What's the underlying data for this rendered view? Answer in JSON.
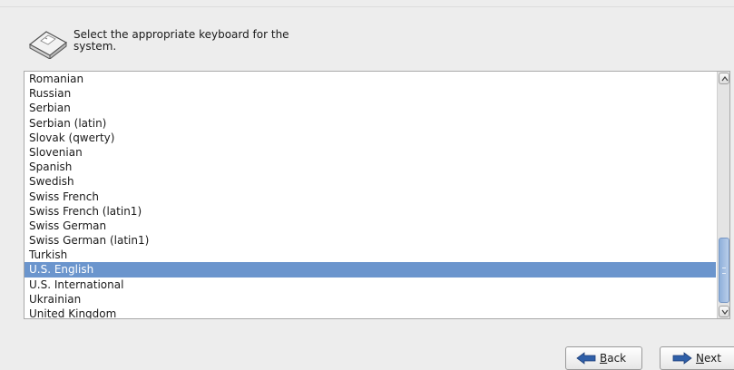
{
  "header": {
    "icon": "keyboard-icon",
    "prompt": "Select the appropriate keyboard for the system."
  },
  "keyboard_list": {
    "items": [
      "Romanian",
      "Russian",
      "Serbian",
      "Serbian (latin)",
      "Slovak (qwerty)",
      "Slovenian",
      "Spanish",
      "Swedish",
      "Swiss French",
      "Swiss French (latin1)",
      "Swiss German",
      "Swiss German (latin1)",
      "Turkish",
      "U.S. English",
      "U.S. International",
      "Ukrainian",
      "United Kingdom"
    ],
    "selected": "U.S. English",
    "selection_color": "#6b95cd"
  },
  "buttons": {
    "back": {
      "mnemonic": "B",
      "rest": "ack",
      "icon": "arrow-left-icon"
    },
    "next": {
      "mnemonic": "N",
      "rest": "ext",
      "icon": "arrow-right-icon"
    }
  }
}
